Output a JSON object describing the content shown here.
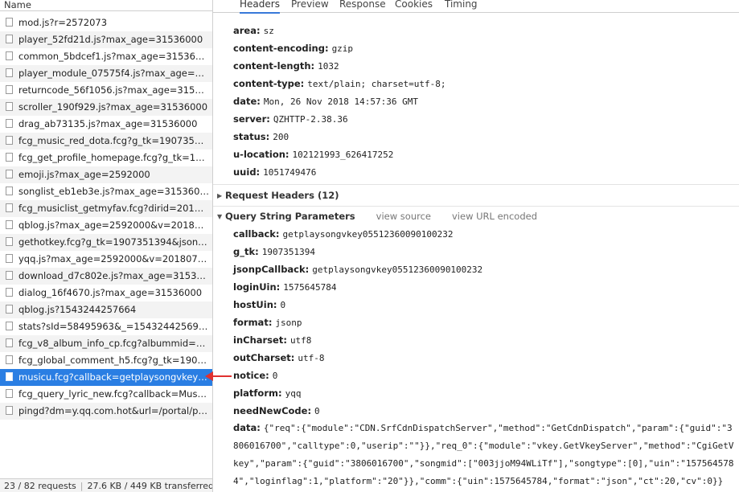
{
  "network": {
    "column_name": "Name",
    "requests": [
      "mod.js?r=2572073",
      "player_52fd21d.js?max_age=31536000",
      "common_5bdcef1.js?max_age=31536000",
      "player_module_07575f4.js?max_age=31536...",
      "returncode_56f1056.js?max_age=31536000",
      "scroller_190f929.js?max_age=31536000",
      "drag_ab73135.js?max_age=31536000",
      "fcg_music_red_dota.fcg?g_tk=1907351394...",
      "fcg_get_profile_homepage.fcg?g_tk=19073...",
      "emoji.js?max_age=2592000",
      "songlist_eb1eb3e.js?max_age=31536000",
      "fcg_musiclist_getmyfav.fcg?dirid=201&diri...",
      "qblog.js?max_age=2592000&v=20180702",
      "gethotkey.fcg?g_tk=1907351394&jsonpCal...",
      "yqq.js?max_age=2592000&v=20180702",
      "download_d7c802e.js?max_age=31536000",
      "dialog_16f4670.js?max_age=31536000",
      "qblog.js?1543244257664",
      "stats?sId=58495963&_=1543244256998",
      "fcg_v8_album_info_cp.fcg?albummid=003c...",
      "fcg_global_comment_h5.fcg?g_tk=1907351...",
      "musicu.fcg?callback=getplaysongvkey0551...",
      "fcg_query_lyric_new.fcg?callback=MusicJso...",
      "pingd?dm=y.qq.com.hot&url=/portal/play..."
    ],
    "selected_index": 21,
    "status": {
      "requests": "23 / 82 requests",
      "transferred": "27.6 KB / 449 KB transferred..."
    }
  },
  "tabs": [
    "Headers",
    "Preview",
    "Response",
    "Cookies",
    "Timing"
  ],
  "active_tab": 0,
  "response_headers": [
    {
      "key": "area:",
      "value": "sz"
    },
    {
      "key": "content-encoding:",
      "value": "gzip"
    },
    {
      "key": "content-length:",
      "value": "1032"
    },
    {
      "key": "content-type:",
      "value": "text/plain; charset=utf-8;"
    },
    {
      "key": "date:",
      "value": "Mon, 26 Nov 2018 14:57:36 GMT"
    },
    {
      "key": "server:",
      "value": "QZHTTP-2.38.36"
    },
    {
      "key": "status:",
      "value": "200"
    },
    {
      "key": "u-location:",
      "value": "102121993_626417252"
    },
    {
      "key": "uuid:",
      "value": "1051749476"
    }
  ],
  "request_headers": {
    "title": "Request Headers (12)"
  },
  "query_string": {
    "title": "Query String Parameters",
    "view_source": "view source",
    "view_url_encoded": "view URL encoded",
    "params": [
      {
        "key": "callback:",
        "value": "getplaysongvkey05512360090100232"
      },
      {
        "key": "g_tk:",
        "value": "1907351394"
      },
      {
        "key": "jsonpCallback:",
        "value": "getplaysongvkey05512360090100232"
      },
      {
        "key": "loginUin:",
        "value": "1575645784"
      },
      {
        "key": "hostUin:",
        "value": "0"
      },
      {
        "key": "format:",
        "value": "jsonp"
      },
      {
        "key": "inCharset:",
        "value": "utf8"
      },
      {
        "key": "outCharset:",
        "value": "utf-8"
      },
      {
        "key": "notice:",
        "value": "0"
      },
      {
        "key": "platform:",
        "value": "yqq"
      },
      {
        "key": "needNewCode:",
        "value": "0"
      }
    ],
    "data": {
      "key": "data:",
      "value": "{\"req\":{\"module\":\"CDN.SrfCdnDispatchServer\",\"method\":\"GetCdnDispatch\",\"param\":{\"guid\":\"3806016700\",\"calltype\":0,\"userip\":\"\"}},\"req_0\":{\"module\":\"vkey.GetVkeyServer\",\"method\":\"CgiGetVkey\",\"param\":{\"guid\":\"3806016700\",\"songmid\":[\"003jjoM94WLiTf\"],\"songtype\":[0],\"uin\":\"1575645784\",\"loginflag\":1,\"platform\":\"20\"}},\"comm\":{\"uin\":1575645784,\"format\":\"json\",\"ct\":20,\"cv\":0}}"
    }
  },
  "colors": {
    "selected": "#2a7ee3",
    "annotation_arrow": "#e0312f"
  }
}
